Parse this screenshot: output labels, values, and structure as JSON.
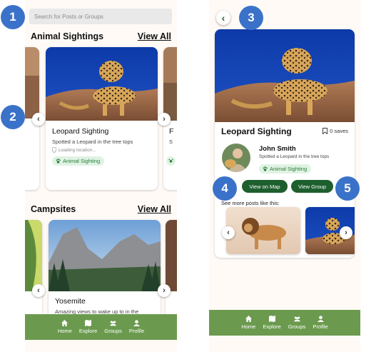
{
  "callouts": [
    "1",
    "2",
    "3",
    "4",
    "5"
  ],
  "search": {
    "placeholder": "Search for Posts or Groups"
  },
  "sections": {
    "animal": {
      "title": "Animal Sightings",
      "view_all": "View All"
    },
    "campsites": {
      "title": "Campsites",
      "view_all": "View All"
    }
  },
  "animal_card": {
    "title": "Leopard Sighting",
    "description": "Spotted a Leopard in the tree tops",
    "location": "Loading location...",
    "tag": "Animal Sighting"
  },
  "peek_card": {
    "title": "F",
    "description": "S"
  },
  "campsite_card": {
    "title": "Yosemite",
    "description": "Amazing views to wake up to in the"
  },
  "nav": [
    {
      "label": "Home",
      "icon": "home-icon"
    },
    {
      "label": "Explore",
      "icon": "map-icon"
    },
    {
      "label": "Groups",
      "icon": "groups-icon"
    },
    {
      "label": "Profile",
      "icon": "profile-icon"
    }
  ],
  "detail": {
    "title": "Leopard Sighting",
    "saves": "0 saves",
    "author": "John Smith",
    "description": "Spotted a Leopard in the tree tops",
    "tag": "Animal Sighting",
    "view_on_map": "View on Map",
    "view_group": "View Group",
    "see_more": "See more posts like this:"
  },
  "colors": {
    "accent_blue": "#3a72c9",
    "nav_green": "#6b9a4e",
    "button_green": "#1e5f2e",
    "tag_bg": "#dff3e3",
    "tag_text": "#2d7a3a"
  }
}
